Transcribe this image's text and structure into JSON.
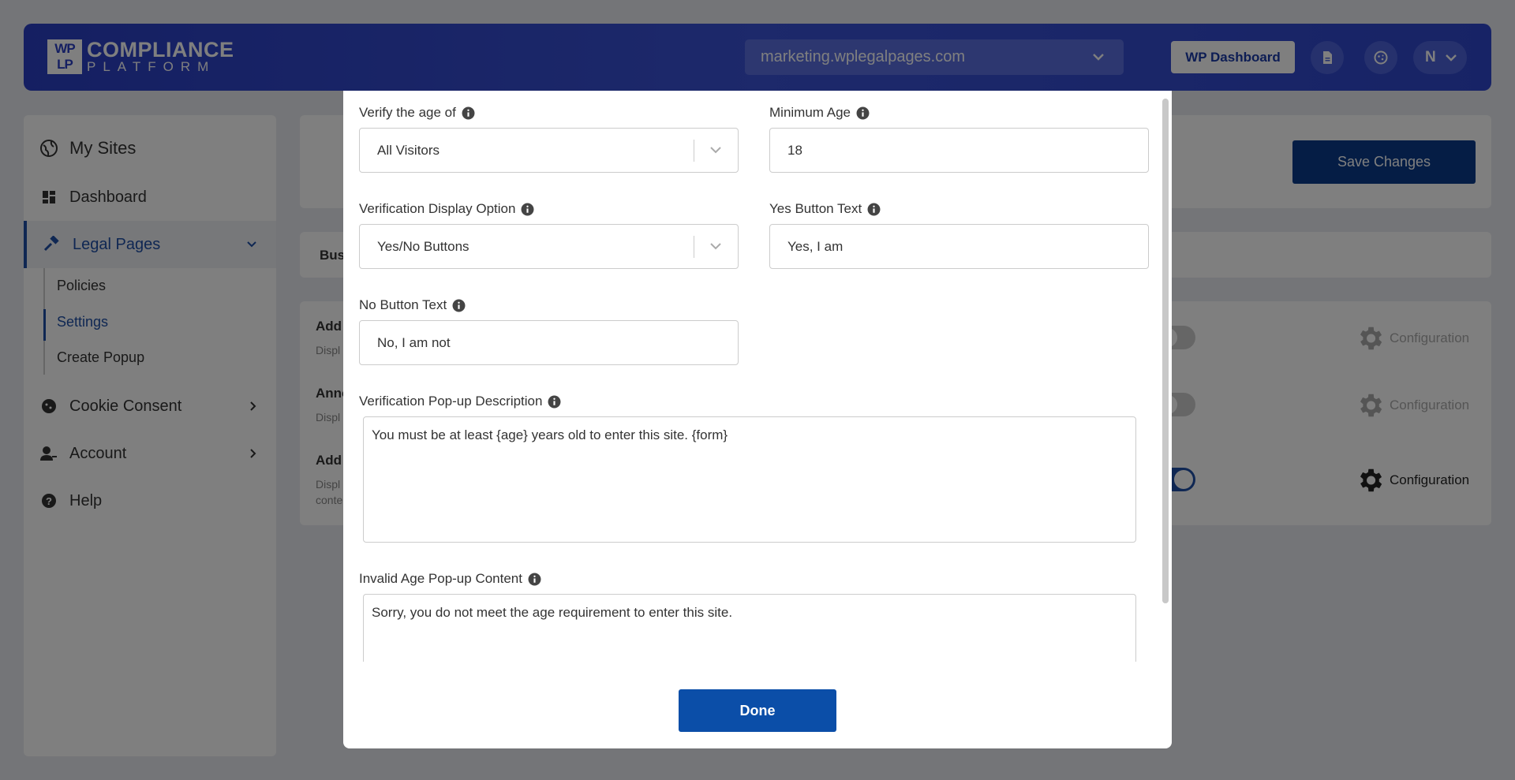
{
  "header": {
    "logo_mark": "WP\nLP",
    "logo_title": "COMPLIANCE",
    "logo_subtitle": "PLATFORM",
    "site_selector": "marketing.wplegalpages.com",
    "wp_dashboard": "WP Dashboard",
    "user_initial": "N"
  },
  "sidebar": {
    "my_sites": "My Sites",
    "dashboard": "Dashboard",
    "legal_pages": "Legal Pages",
    "sub_items": [
      "Policies",
      "Settings",
      "Create Popup"
    ],
    "cookie_consent": "Cookie Consent",
    "account": "Account",
    "help": "Help"
  },
  "main": {
    "save_changes": "Save Changes",
    "tab_label": "Bus",
    "rows": [
      {
        "title": "Add",
        "desc": "Displ",
        "config": "Configuration"
      },
      {
        "title": "Anno",
        "desc": "Displ",
        "config": "Configuration"
      },
      {
        "title": "Add",
        "desc": "Displ",
        "desc2": "conte",
        "config": "Configuration"
      }
    ]
  },
  "modal": {
    "verify_age_label": "Verify the age of",
    "verify_age_value": "All Visitors",
    "min_age_label": "Minimum Age",
    "min_age_value": "18",
    "display_option_label": "Verification Display Option",
    "display_option_value": "Yes/No Buttons",
    "yes_text_label": "Yes Button Text",
    "yes_text_value": "Yes, I am",
    "no_text_label": "No Button Text",
    "no_text_value": "No, I am not",
    "description_label": "Verification Pop-up Description",
    "description_value": "You must be at least {age} years old to enter this site. {form}",
    "invalid_label": "Invalid Age Pop-up Content",
    "invalid_value": "Sorry, you do not meet the age requirement to enter this site.",
    "done": "Done"
  }
}
